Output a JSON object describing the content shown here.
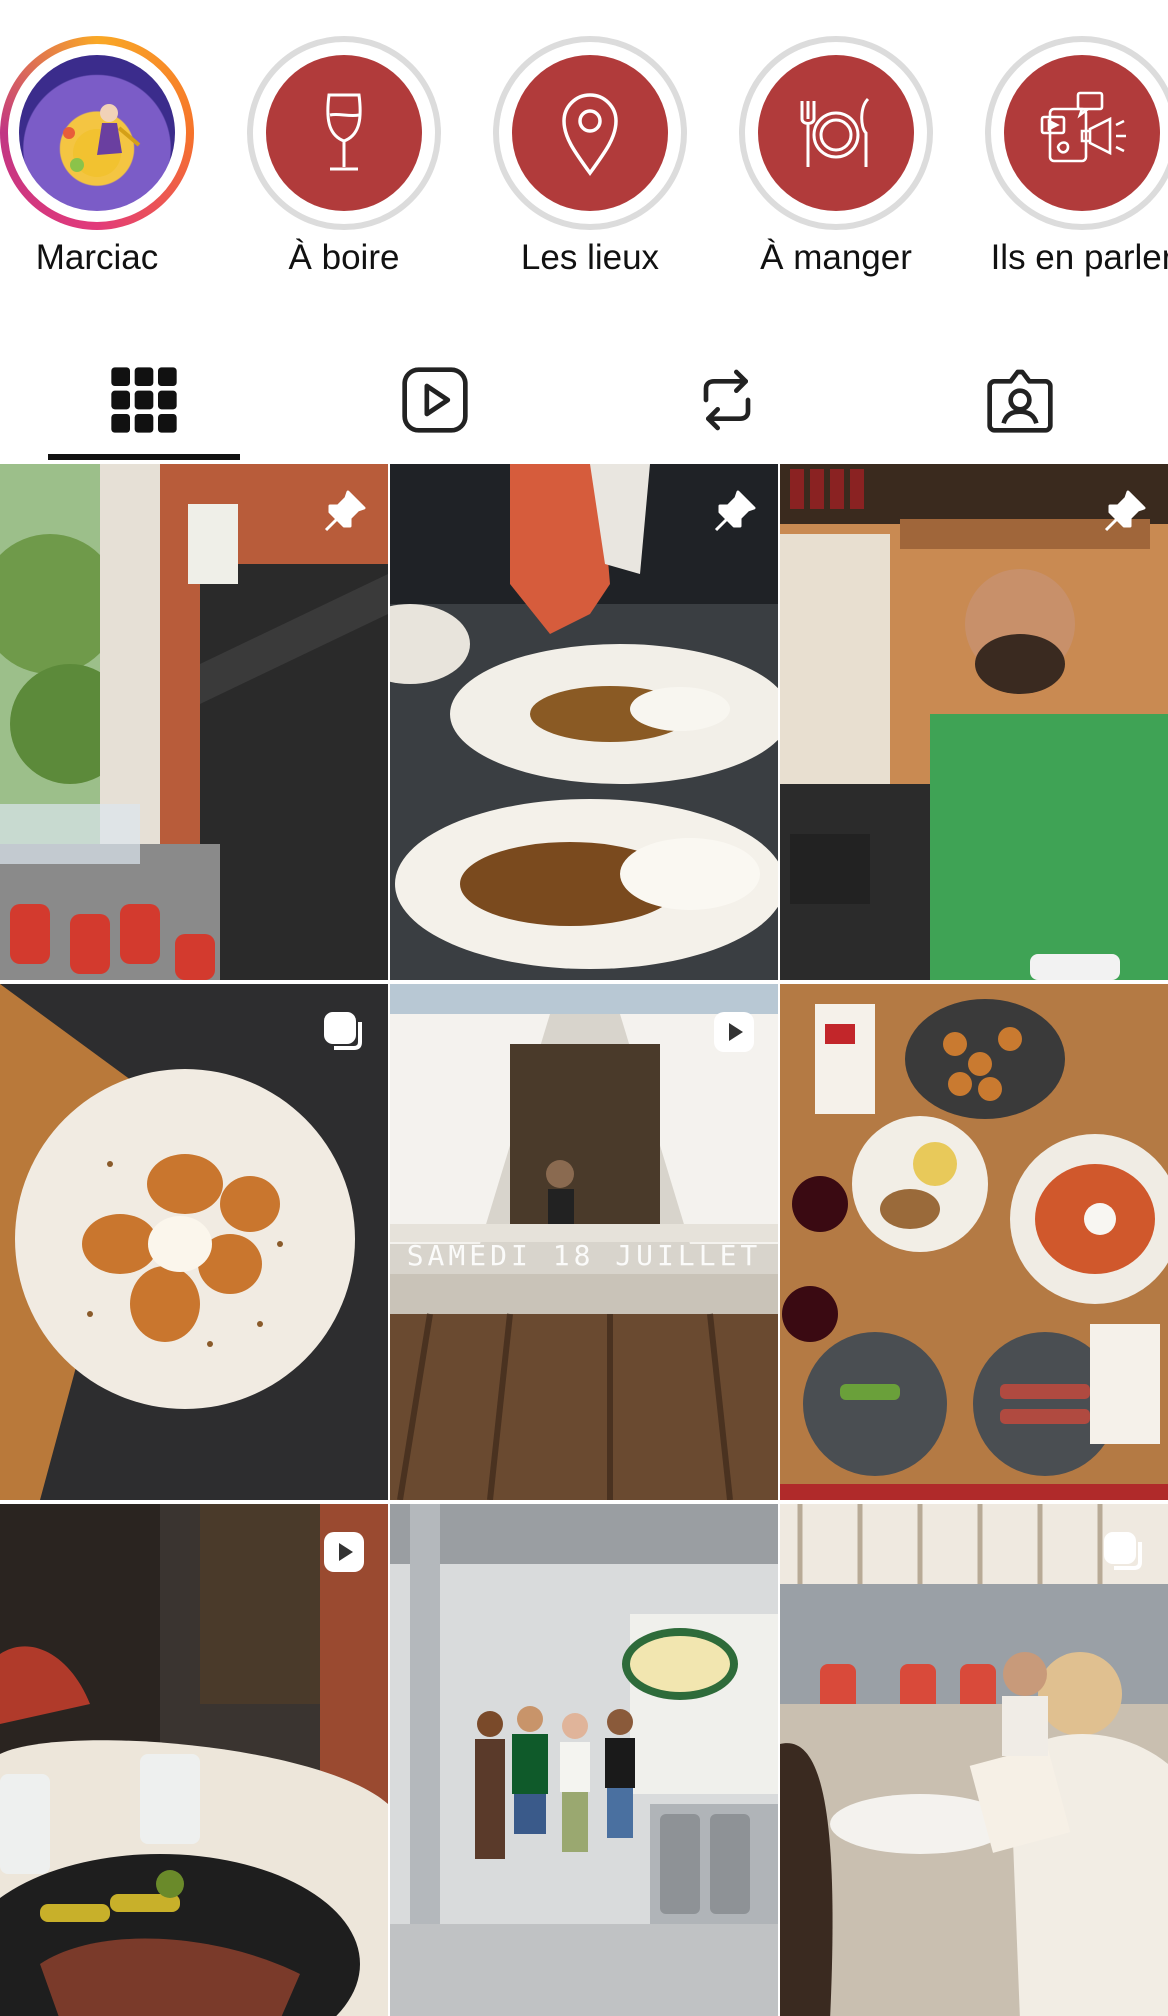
{
  "highlights": [
    {
      "label": "Marciac",
      "icon": "jazz-illustration-icon"
    },
    {
      "label": "À boire",
      "icon": "wine-glass-icon"
    },
    {
      "label": "Les lieux",
      "icon": "location-pin-icon"
    },
    {
      "label": "À manger",
      "icon": "plate-cutlery-icon"
    },
    {
      "label": "Ils en parler",
      "icon": "media-megaphone-icon"
    }
  ],
  "tabs": [
    {
      "name": "grid",
      "icon": "grid-icon",
      "active": true
    },
    {
      "name": "reels",
      "icon": "reels-icon",
      "active": false
    },
    {
      "name": "reposts",
      "icon": "repost-icon",
      "active": false
    },
    {
      "name": "tagged",
      "icon": "tagged-icon",
      "active": false
    }
  ],
  "posts": [
    {
      "subject": "restaurant-facade",
      "badge": "pin-icon"
    },
    {
      "subject": "chef-plating",
      "badge": "pin-icon"
    },
    {
      "subject": "man-on-phone",
      "badge": "pin-icon"
    },
    {
      "subject": "dessert-plate",
      "badge": "carousel-icon"
    },
    {
      "subject": "balcony-event",
      "badge": "reel-icon",
      "overlay_text": "SAMEDI 18 JUILLET"
    },
    {
      "subject": "table-spread",
      "badge": ""
    },
    {
      "subject": "steak-dinner",
      "badge": "reel-icon"
    },
    {
      "subject": "brewery-group",
      "badge": ""
    },
    {
      "subject": "terrace-diners",
      "badge": "carousel-icon"
    }
  ],
  "colors": {
    "highlight_red": "#b13b3b",
    "ring_grey": "#dcdcdc",
    "text": "#111111"
  }
}
